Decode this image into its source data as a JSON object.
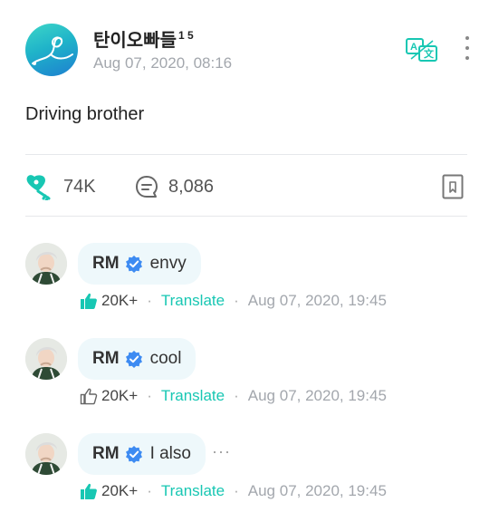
{
  "post": {
    "author": "탄이오빠들",
    "author_badge": "1 5",
    "timestamp": "Aug 07, 2020, 08:16",
    "body": "Driving brother",
    "likes": "74K",
    "comments": "8,086"
  },
  "comments": [
    {
      "author": "RM",
      "text": "envy",
      "likes": "20K+",
      "liked": true,
      "translate": "Translate",
      "timestamp": "Aug 07, 2020, 19:45"
    },
    {
      "author": "RM",
      "text": "cool",
      "likes": "20K+",
      "liked": false,
      "translate": "Translate",
      "timestamp": "Aug 07, 2020, 19:45"
    },
    {
      "author": "RM",
      "text": "I also",
      "likes": "20K+",
      "liked": true,
      "translate": "Translate",
      "timestamp": "Aug 07, 2020, 19:45",
      "more": "···"
    }
  ],
  "icons": {
    "accent": "#18c7b3",
    "verified": "#3d8bf2",
    "translate": "translate-icon",
    "more": "more-vert-icon",
    "likes": "key-heart-icon",
    "comments": "chat-bubble-icon",
    "bookmark": "bookmark-icon"
  }
}
